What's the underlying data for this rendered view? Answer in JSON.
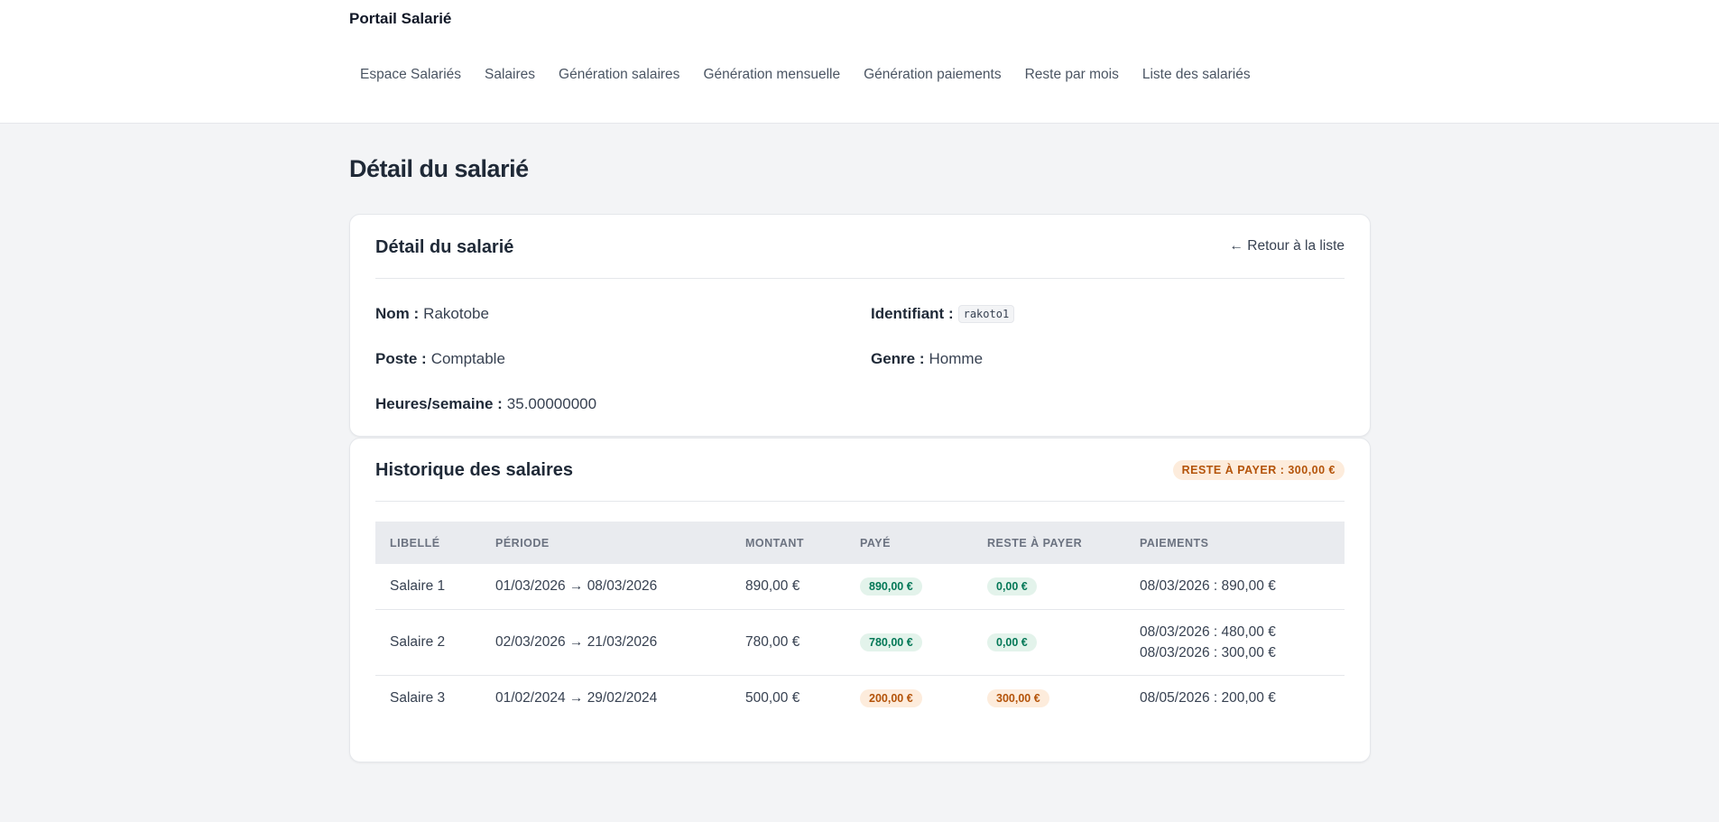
{
  "app": {
    "brand": "Portail Salarié"
  },
  "nav": [
    "Espace Salariés",
    "Salaires",
    "Génération salaires",
    "Génération mensuelle",
    "Génération paiements",
    "Reste par mois",
    "Liste des salariés"
  ],
  "page": {
    "title": "Détail du salarié"
  },
  "details_card": {
    "title": "Détail du salarié",
    "back_link": "← Retour à la liste",
    "nom_label": "Nom :",
    "nom_value": "Rakotobe",
    "identifiant_label": "Identifiant :",
    "identifiant_value": "rakoto1",
    "poste_label": "Poste :",
    "poste_value": "Comptable",
    "genre_label": "Genre :",
    "genre_value": "Homme",
    "heures_label": "Heures/semaine :",
    "heures_value": "35.00000000"
  },
  "history_card": {
    "title": "Historique des salaires",
    "remaining_badge": "Reste à payer : 300,00 €",
    "columns": [
      "Libellé",
      "Période",
      "Montant",
      "Payé",
      "Reste à payer",
      "Paiements"
    ],
    "rows": [
      {
        "libelle": "Salaire 1",
        "periode": "01/03/2026 → 08/03/2026",
        "montant": "890,00 €",
        "paye": "890,00 €",
        "reste": "0,00 €",
        "paiements": [
          "08/03/2026 : 890,00 €"
        ]
      },
      {
        "libelle": "Salaire 2",
        "periode": "02/03/2026 → 21/03/2026",
        "montant": "780,00 €",
        "paye": "780,00 €",
        "reste": "0,00 €",
        "paiements": [
          "08/03/2026 : 480,00 €",
          "08/03/2026 : 300,00 €"
        ]
      },
      {
        "libelle": "Salaire 3",
        "periode": "01/02/2024 → 29/02/2024",
        "montant": "500,00 €",
        "paye": "200,00 €",
        "reste": "300,00 €",
        "paiements": [
          "08/05/2026 : 200,00 €"
        ]
      }
    ]
  },
  "colors": {
    "paid_badge_bg": "#e3f3eb",
    "paid_badge_text": "#047857",
    "due_badge_bg": "#fdecdc",
    "due_badge_text": "#b45309"
  }
}
